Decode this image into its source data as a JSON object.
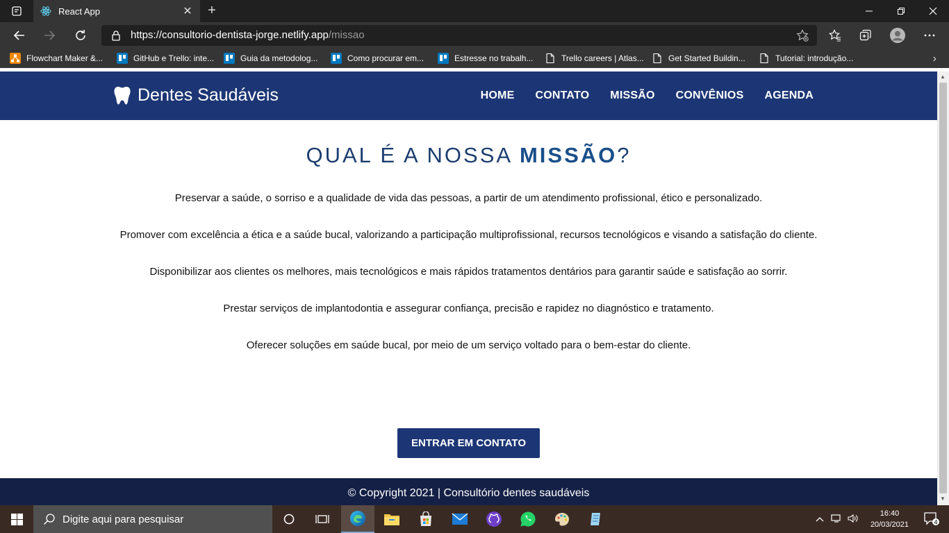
{
  "browser": {
    "tab_title": "React App",
    "url_main": "https://consultorio-dentista-jorge.netlify.app",
    "url_path": "/missao",
    "bookmarks": [
      {
        "label": "Flowchart Maker &...",
        "icon": "drawio-icon",
        "color": "#f08705"
      },
      {
        "label": "GitHub e Trello: inte...",
        "icon": "trello-icon",
        "color": "#0079bf"
      },
      {
        "label": "Guia da metodolog...",
        "icon": "trello-icon",
        "color": "#0079bf"
      },
      {
        "label": "Como procurar em...",
        "icon": "trello-icon",
        "color": "#0079bf"
      },
      {
        "label": "Estresse no trabalh...",
        "icon": "trello-icon",
        "color": "#0079bf"
      },
      {
        "label": "Trello careers | Atlas...",
        "icon": "page-icon",
        "color": "#ffffff"
      },
      {
        "label": "Get Started Buildin...",
        "icon": "page-icon",
        "color": "#ffffff"
      },
      {
        "label": "Tutorial: introdução...",
        "icon": "page-icon",
        "color": "#ffffff"
      }
    ]
  },
  "site": {
    "brand": "Dentes Saudáveis",
    "nav": [
      "HOME",
      "CONTATO",
      "MISSÃO",
      "CONVÊNIOS",
      "AGENDA"
    ],
    "title_light": "QUAL É A NOSSA",
    "title_bold": "MISSÃO",
    "title_end": "?",
    "statements": [
      "Preservar a saúde, o sorriso e a qualidade de vida das pessoas, a partir de um atendimento profissional, ético e personalizado.",
      "Promover com excelência a ética e a saúde bucal, valorizando a participação multiprofissional, recursos tecnológicos e visando a satisfação do cliente.",
      "Disponibilizar aos clientes os melhores, mais tecnológicos e mais rápidos tratamentos dentários para garantir saúde e satisfação ao sorrir.",
      "Prestar serviços de implantodontia e assegurar confiança, precisão e rapidez no diagnóstico e tratamento.",
      "Oferecer soluções em saúde bucal, por meio de um serviço voltado para o bem-estar do cliente."
    ],
    "cta": "ENTRAR EM CONTATO",
    "footer": "© Copyright 2021 | Consultório dentes saudáveis",
    "colors": {
      "header": "#1c3675",
      "footer": "#152046",
      "title": "#1c3e6f"
    }
  },
  "taskbar": {
    "search_placeholder": "Digite aqui para pesquisar",
    "time": "16:40",
    "date": "20/03/2021",
    "notifications": "4"
  }
}
